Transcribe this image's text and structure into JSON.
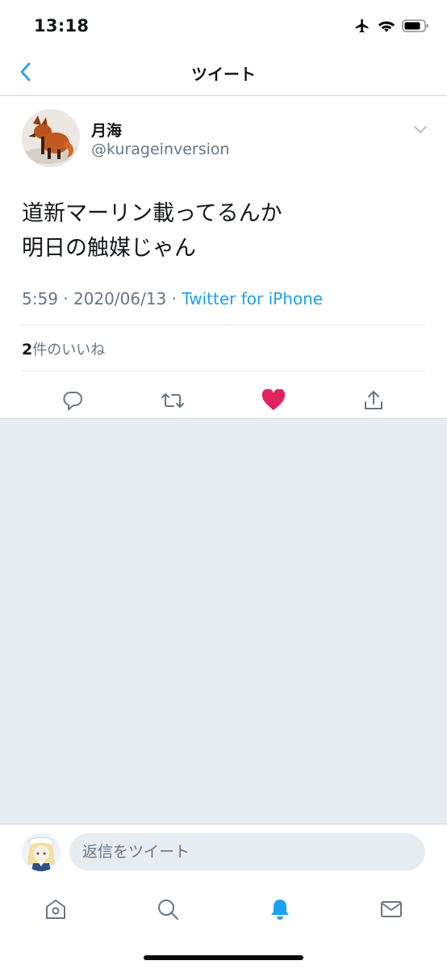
{
  "status_bar": {
    "time": "13:18"
  },
  "nav": {
    "title": "ツイート"
  },
  "tweet": {
    "author_name": "月海",
    "author_handle": "@kurageinversion",
    "text": "道新マーリン載ってるんか\n明日の触媒じゃん",
    "time": "5:59",
    "date": "2020/06/13",
    "source": "Twitter for iPhone",
    "likes_count": "2",
    "likes_label": "件のいいね",
    "liked": true
  },
  "reply": {
    "placeholder": "返信をツイート"
  },
  "colors": {
    "accent": "#1da1f2",
    "like": "#e0245e",
    "secondary_text": "#657786"
  },
  "icons": {
    "actions": [
      "reply-icon",
      "retweet-icon",
      "like-icon",
      "share-icon"
    ],
    "tabs": [
      "home-icon",
      "search-icon",
      "notifications-icon",
      "messages-icon"
    ]
  }
}
